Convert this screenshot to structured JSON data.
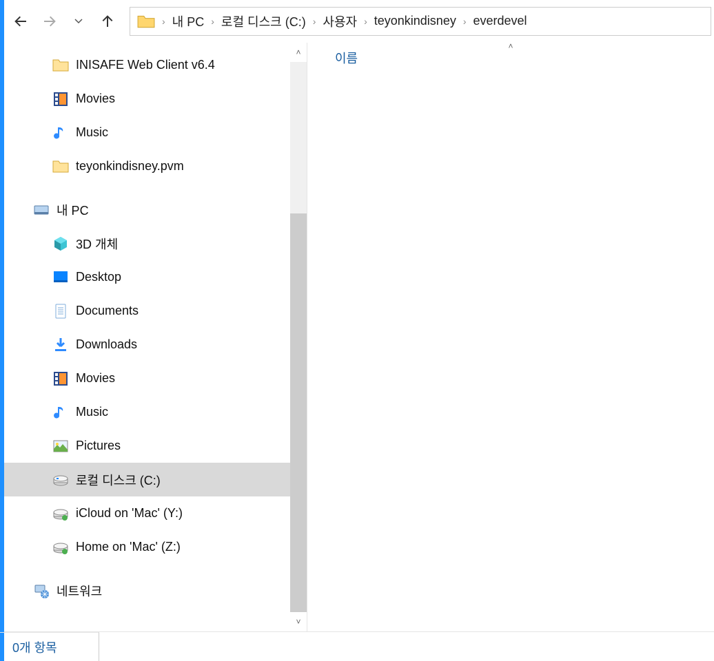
{
  "breadcrumbs": [
    {
      "label": "내 PC"
    },
    {
      "label": "로컬 디스크 (C:)"
    },
    {
      "label": "사용자"
    },
    {
      "label": "teyonkindisney"
    },
    {
      "label": "everdevel"
    }
  ],
  "sidebar": {
    "items": [
      {
        "label": "INISAFE Web Client v6.4",
        "icon": "folder",
        "level": 1
      },
      {
        "label": "Movies",
        "icon": "film",
        "level": 1
      },
      {
        "label": "Music",
        "icon": "music",
        "level": 1
      },
      {
        "label": "teyonkindisney.pvm",
        "icon": "folder",
        "level": 1
      },
      {
        "label": "내 PC",
        "icon": "pc",
        "level": 0,
        "gap_before": true
      },
      {
        "label": "3D 개체",
        "icon": "cube3d",
        "level": 1
      },
      {
        "label": "Desktop",
        "icon": "desktop",
        "level": 1
      },
      {
        "label": "Documents",
        "icon": "document",
        "level": 1
      },
      {
        "label": "Downloads",
        "icon": "download",
        "level": 1
      },
      {
        "label": "Movies",
        "icon": "film",
        "level": 1
      },
      {
        "label": "Music",
        "icon": "music",
        "level": 1
      },
      {
        "label": "Pictures",
        "icon": "pictures",
        "level": 1
      },
      {
        "label": "로컬 디스크 (C:)",
        "icon": "disk",
        "level": 1,
        "selected": true
      },
      {
        "label": "iCloud on 'Mac' (Y:)",
        "icon": "netdisk",
        "level": 1
      },
      {
        "label": "Home on 'Mac' (Z:)",
        "icon": "netdisk",
        "level": 1
      },
      {
        "label": "네트워크",
        "icon": "network",
        "level": 0,
        "gap_before": true
      }
    ]
  },
  "content": {
    "column_name": "이름"
  },
  "status": {
    "text": "0개 항목"
  }
}
